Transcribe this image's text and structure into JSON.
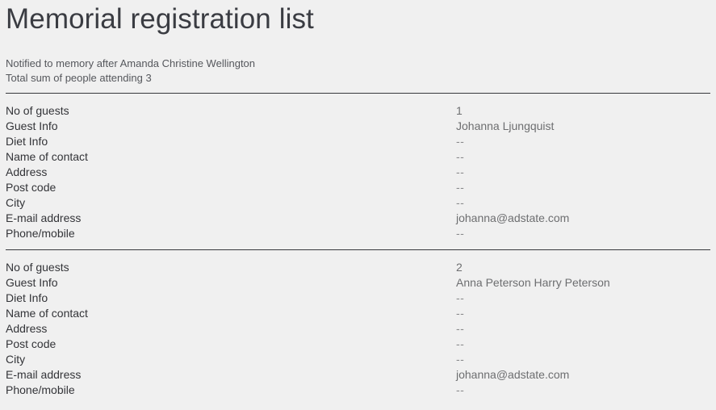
{
  "document": {
    "title": "Memorial registration list",
    "subtitle_lines": [
      "Notified to memory after Amanda Christine Wellington",
      "Total sum of people attending 3"
    ],
    "labels": [
      "No of guests",
      "Guest Info",
      "Diet Info",
      "Name of contact",
      "Address",
      "Post code",
      "City",
      "E-mail address",
      "Phone/mobile"
    ],
    "empty_value": "--",
    "records": [
      {
        "no_of_guests": "1",
        "guest_info": "Johanna Ljungquist",
        "diet_info": "--",
        "name_of_contact": "--",
        "address": "--",
        "post_code": "--",
        "city": "--",
        "email_address": "johanna@adstate.com",
        "phone_mobile": "--"
      },
      {
        "no_of_guests": "2",
        "guest_info": "Anna Peterson Harry Peterson",
        "diet_info": "--",
        "name_of_contact": "--",
        "address": "--",
        "post_code": "--",
        "city": "--",
        "email_address": "johanna@adstate.com",
        "phone_mobile": "--"
      }
    ]
  },
  "colors": {
    "background": "#f0f0f0",
    "title_text": "#3a3c42",
    "label_text": "#333438",
    "value_text": "#6d6e70",
    "subtitle_text": "#55575c",
    "divider": "#37393d"
  }
}
